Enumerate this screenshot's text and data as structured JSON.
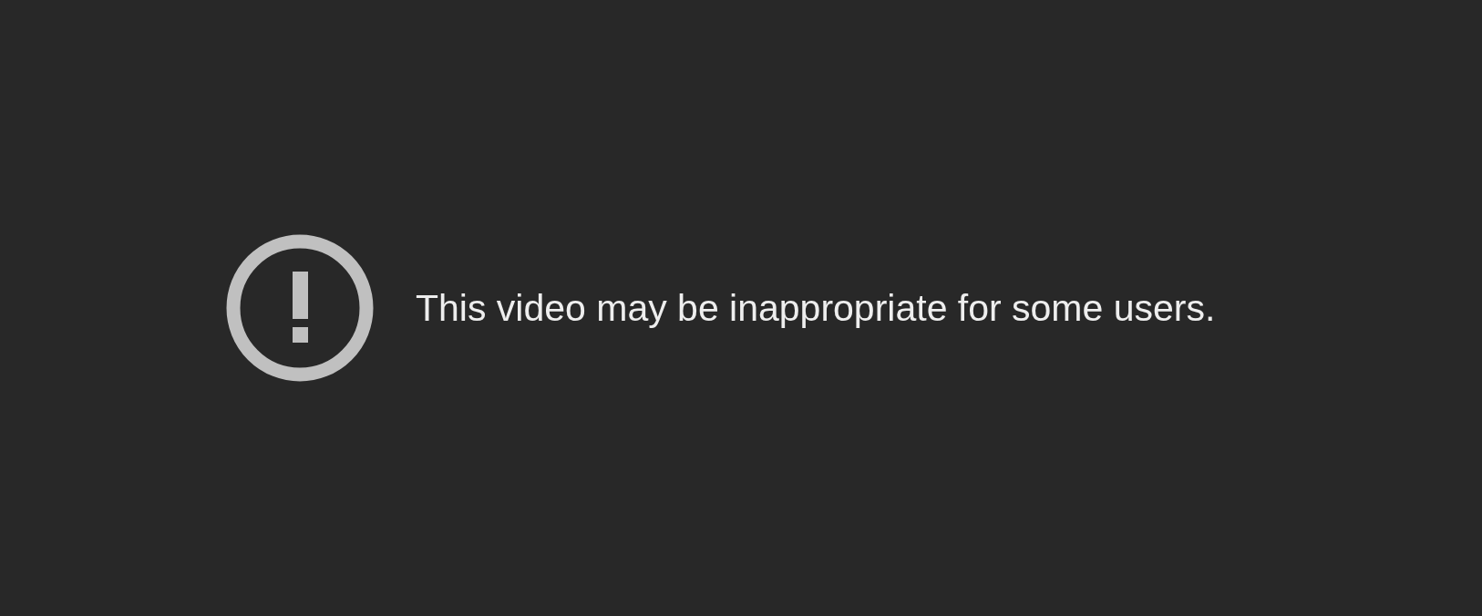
{
  "message": "This video may be inappropriate for some users."
}
